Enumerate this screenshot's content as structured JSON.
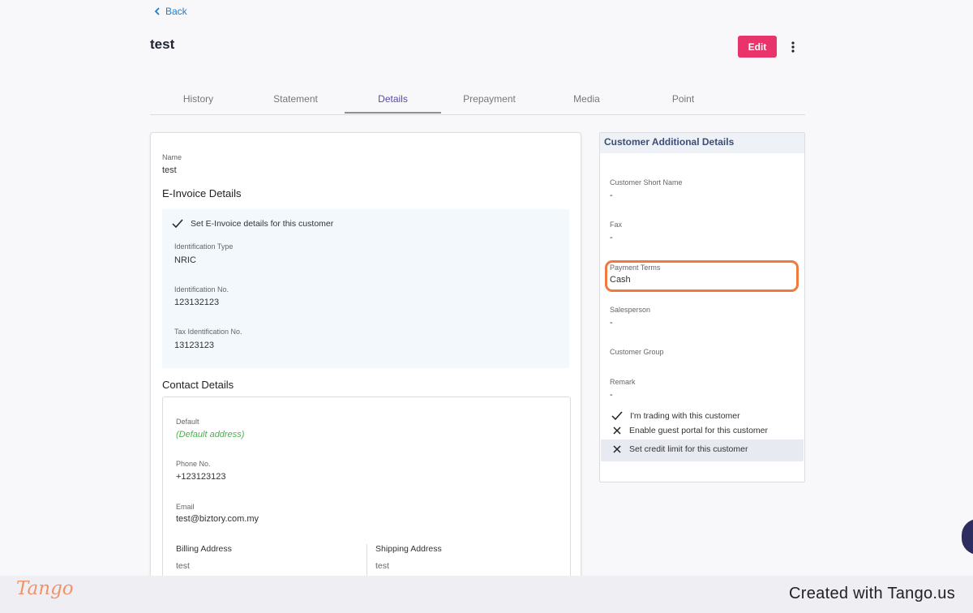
{
  "nav": {
    "back_label": "Back"
  },
  "page": {
    "title": "test"
  },
  "toolbar": {
    "edit_label": "Edit"
  },
  "tabs": [
    {
      "label": "History"
    },
    {
      "label": "Statement"
    },
    {
      "label": "Details"
    },
    {
      "label": "Prepayment"
    },
    {
      "label": "Media"
    },
    {
      "label": "Point"
    }
  ],
  "details": {
    "name_label": "Name",
    "name_value": "test",
    "einvoice_title": "E-Invoice Details",
    "einvoice_check": "Set E-Invoice details for this customer",
    "id_type_label": "Identification Type",
    "id_type_value": "NRIC",
    "id_no_label": "Identification No.",
    "id_no_value": "123132123",
    "tax_id_label": "Tax Identification No.",
    "tax_id_value": "13123123",
    "contact_title": "Contact Details",
    "default_label": "Default",
    "default_value": "(Default address)",
    "phone_label": "Phone No.",
    "phone_value": "+123123123",
    "email_label": "Email",
    "email_value": "test@biztory.com.my",
    "billing_label": "Billing Address",
    "billing_value": "test",
    "shipping_label": "Shipping Address",
    "shipping_value": "test"
  },
  "additional": {
    "title": "Customer Additional Details",
    "short_name_label": "Customer Short Name",
    "short_name_value": "-",
    "fax_label": "Fax",
    "fax_value": "-",
    "payment_terms_label": "Payment Terms",
    "payment_terms_value": "Cash",
    "salesperson_label": "Salesperson",
    "salesperson_value": "-",
    "group_label": "Customer Group",
    "remark_label": "Remark",
    "remark_value": "-",
    "trading": "I'm trading with this customer",
    "guest_portal": "Enable guest portal for this customer",
    "credit_limit": "Set credit limit for this customer"
  },
  "footer": {
    "brand": "Tango",
    "created": "Created with Tango.us"
  },
  "colors": {
    "accent": "#e8336b",
    "link": "#1a7fcf",
    "highlight": "#ef7a3e",
    "default_green": "#4caf50"
  }
}
